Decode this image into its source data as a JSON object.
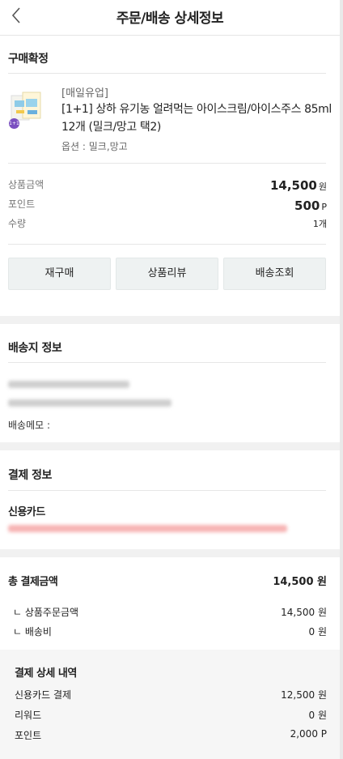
{
  "header": {
    "title": "주문/배송 상세정보"
  },
  "order": {
    "section_title": "구매확정",
    "brand": "[매일유업]",
    "product_name": "[1+1] 상하 유기농 얼려먹는 아이스크림/아이스주스 85ml 12개 (밀크/망고 택2)",
    "option": "옵션 : 밀크,망고",
    "badge": "1+1",
    "price_label": "상품금액",
    "price_value": "14,500",
    "price_unit": "원",
    "point_label": "포인트",
    "point_value": "500",
    "point_unit": "P",
    "qty_label": "수량",
    "qty_value": "1개",
    "buttons": [
      "재구매",
      "상품리뷰",
      "배송조회"
    ]
  },
  "shipping": {
    "section_title": "배송지 정보",
    "memo_label": "배송메모 :"
  },
  "payment": {
    "section_title": "결제 정보",
    "method": "신용카드"
  },
  "totals": {
    "total_label": "총 결제금액",
    "total_value": "14,500 원",
    "rows": [
      {
        "label": "ㄴ 상품주문금액",
        "value": "14,500 원"
      },
      {
        "label": "ㄴ 배송비",
        "value": "0 원"
      }
    ]
  },
  "detail": {
    "section_title": "결제 상세 내역",
    "rows": [
      {
        "label": "신용카드 결제",
        "value": "12,500 원"
      },
      {
        "label": "리워드",
        "value": "0 원"
      },
      {
        "label": "포인트",
        "value": "2,000 P"
      }
    ]
  }
}
